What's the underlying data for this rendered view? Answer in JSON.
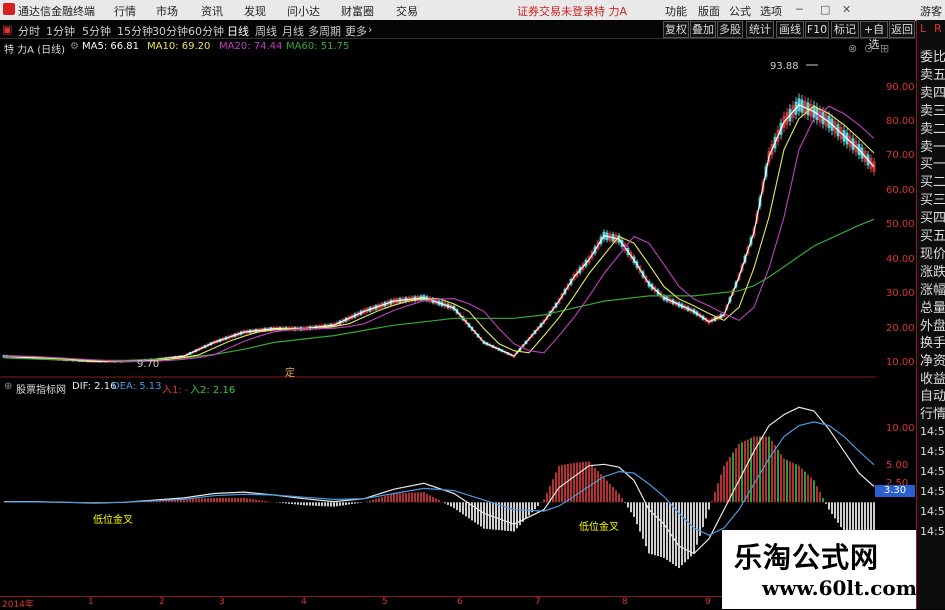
{
  "app": {
    "title": "通达信金融终端",
    "login_status": "证券交易未登录",
    "stock_name": "特 力A",
    "guest": "游客"
  },
  "menu": [
    "行情",
    "市场",
    "资讯",
    "发现",
    "问小达",
    "财富圈",
    "交易"
  ],
  "toolbar_right": [
    "功能",
    "版面",
    "公式",
    "选项"
  ],
  "periods": [
    "分时",
    "1分钟",
    "5分钟",
    "15分钟",
    "30分钟",
    "60分钟",
    "日线",
    "周线",
    "月线",
    "多周期",
    "更多"
  ],
  "active_period": "日线",
  "tools": [
    "复权",
    "叠加",
    "多股",
    "统计",
    "画线",
    "F10",
    "标记",
    "+自选",
    "返回"
  ],
  "main_legend": {
    "stock": "特 力A (日线)",
    "ma5": "MA5: 66.81",
    "ma10": "MA10: 69.20",
    "ma20": "MA20: 74.44",
    "ma60": "MA60: 51.75"
  },
  "macd_legend": {
    "name": "股票指标网",
    "dif": "DIF: 2.16",
    "dea": "DEA: 5.13",
    "in1": "入1: -",
    "in2": "入2: 2.16"
  },
  "price_axis": [
    "90.00",
    "80.00",
    "70.00",
    "60.00",
    "50.00",
    "40.00",
    "30.00",
    "20.00",
    "10.00"
  ],
  "macd_axis": [
    "10.00",
    "5.00",
    "2.50"
  ],
  "macd_value_label": "3.30",
  "annotations": {
    "high": "93.88",
    "low": "9.70",
    "marker": "定",
    "golden_cross_1": "低位金叉",
    "golden_cross_2": "低位金叉"
  },
  "dates": [
    "2014年",
    "1",
    "2",
    "3",
    "4",
    "5",
    "6",
    "7",
    "8",
    "9"
  ],
  "right_panel": {
    "rl": "L",
    "rr": "R",
    "items": [
      "委比",
      "卖五",
      "卖四",
      "卖三",
      "卖二",
      "卖一",
      "买一",
      "买二",
      "买三",
      "买四",
      "买五",
      "现价",
      "涨跌",
      "涨幅",
      "总量",
      "外盘",
      "换手",
      "净资",
      "收益"
    ],
    "items2": [
      "自动",
      "行情"
    ],
    "times": [
      "14:5",
      "14:5",
      "14:5",
      "14:5",
      "14:5",
      "14:5"
    ]
  },
  "watermark": {
    "title": "乐淘公式网",
    "url": "www.60lt.com"
  },
  "colors": {
    "up": "#e23b3b",
    "down": "#5fd0d9",
    "ma5": "#ffffff",
    "ma10": "#e8e85a",
    "ma20": "#c040c0",
    "ma60": "#33aa33",
    "dif": "#e8e8e8",
    "dea": "#4a9ae0",
    "golden": "#ffff00"
  },
  "chart_data": {
    "type": "line",
    "title": "特 力A (日线)",
    "ylim": [
      8,
      98
    ],
    "x": [
      0,
      10,
      20,
      30,
      40,
      50,
      60,
      70,
      80,
      90,
      100,
      110,
      120,
      130,
      140,
      150,
      160,
      170,
      180,
      185,
      190,
      195,
      200,
      205,
      210,
      215,
      220,
      225,
      230,
      235,
      240,
      245,
      250,
      255,
      260,
      265,
      270,
      275,
      280,
      285,
      290
    ],
    "series": [
      {
        "name": "MA5",
        "values": [
          12,
          11.5,
          11,
          10.5,
          10.5,
          11,
          12,
          16,
          19,
          20,
          20,
          21,
          25,
          28,
          29,
          26,
          16,
          12,
          22,
          28,
          35,
          40,
          47,
          46,
          40,
          33,
          29,
          27,
          25,
          22,
          24,
          35,
          48,
          70,
          80,
          85,
          83,
          80,
          76,
          72,
          67
        ]
      },
      {
        "name": "MA60",
        "values": [
          11.5,
          11.2,
          11,
          10.8,
          10.8,
          11,
          11.5,
          12.5,
          14,
          16,
          17,
          18,
          19.5,
          21,
          22,
          23,
          23,
          23,
          24,
          25,
          26,
          27,
          28,
          28.5,
          29,
          29.5,
          29.5,
          29.5,
          29.5,
          30,
          30.5,
          31,
          32.5,
          35,
          38,
          41,
          44,
          46,
          48,
          50,
          51.75
        ]
      }
    ]
  },
  "macd_chart": {
    "type": "bar",
    "ylim": [
      -12,
      14
    ],
    "x": [
      0,
      10,
      20,
      30,
      40,
      50,
      60,
      70,
      80,
      90,
      100,
      110,
      120,
      130,
      140,
      150,
      160,
      170,
      180,
      185,
      190,
      195,
      200,
      205,
      210,
      215,
      220,
      225,
      230,
      235,
      240,
      245,
      250,
      255,
      260,
      265,
      270,
      275,
      280,
      285,
      290
    ],
    "dif": [
      0.1,
      0.1,
      0,
      -0.1,
      0,
      0.3,
      0.6,
      1.2,
      1.4,
      1,
      0.5,
      0.1,
      0.5,
      1.8,
      2.6,
      1.2,
      -1.5,
      -3,
      -1,
      2,
      3.5,
      5,
      5.2,
      4.8,
      3,
      -1,
      -3,
      -6,
      -7,
      -5,
      -1,
      3,
      7,
      10.5,
      12,
      13,
      12.5,
      10,
      7,
      4,
      2.16
    ],
    "dea": [
      0.05,
      0.05,
      0,
      -0.05,
      0,
      0.2,
      0.4,
      0.9,
      1.1,
      1,
      0.7,
      0.4,
      0.5,
      1.2,
      1.9,
      1.6,
      0.3,
      -1,
      -1.2,
      -0.5,
      0.8,
      2.2,
      3.5,
      4.2,
      4,
      2.5,
      0.8,
      -1.5,
      -3.5,
      -4.5,
      -3.5,
      -1,
      2.5,
      6,
      9,
      10.5,
      11,
      10.5,
      9,
      7,
      5.13
    ]
  }
}
